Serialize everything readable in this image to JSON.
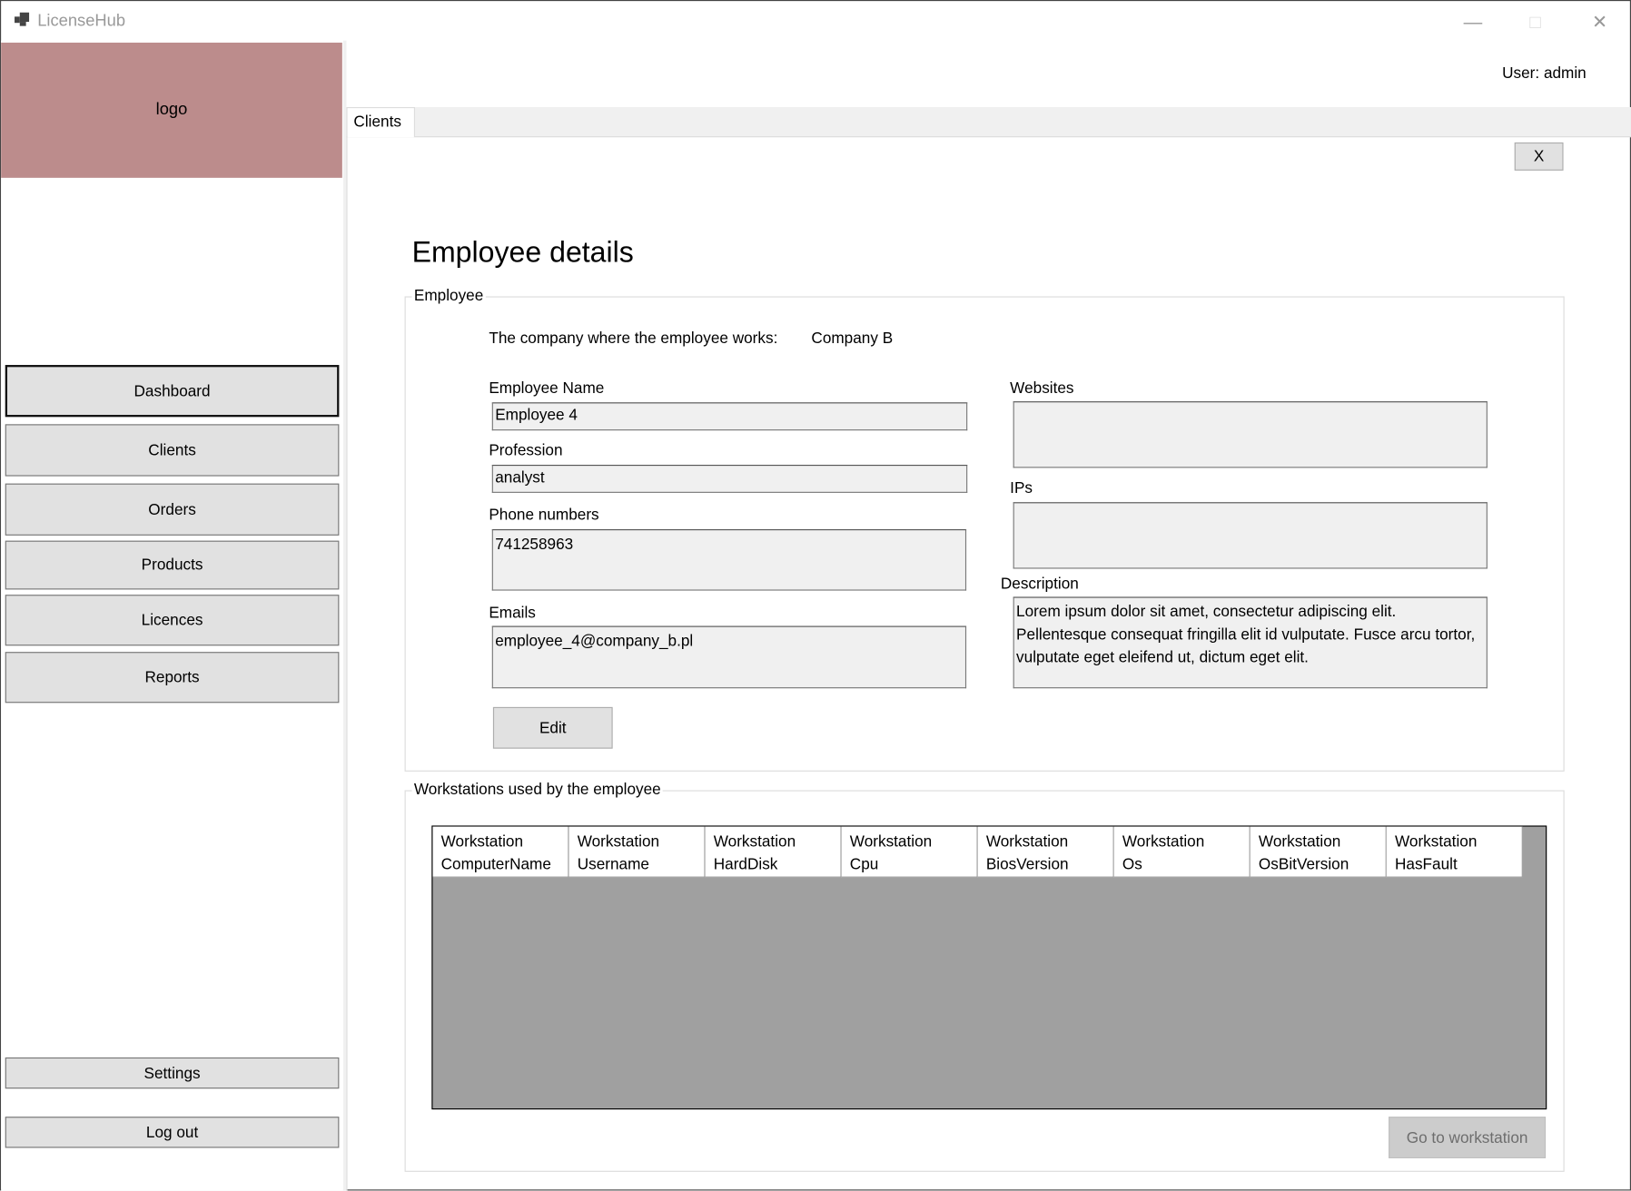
{
  "window": {
    "title": "LicenseHub",
    "controls": [
      "minimize",
      "maximize",
      "close"
    ]
  },
  "sidebar": {
    "logo": "logo",
    "items": [
      {
        "label": "Dashboard",
        "active": true
      },
      {
        "label": "Clients"
      },
      {
        "label": "Orders"
      },
      {
        "label": "Products"
      },
      {
        "label": "Licences"
      },
      {
        "label": "Reports"
      }
    ],
    "settings": "Settings",
    "logout": "Log out"
  },
  "header": {
    "user": "User: admin"
  },
  "tabs": [
    {
      "label": "Clients",
      "active": true
    }
  ],
  "page": {
    "close_label": "X",
    "title": "Employee details",
    "employee_group": {
      "legend": "Employee",
      "company_label": "The company where the employee works:",
      "company_value": "Company B",
      "name_label": "Employee Name",
      "name_value": "Employee 4",
      "profession_label": "Profession",
      "profession_value": "analyst",
      "phones_label": "Phone numbers",
      "phones_value": "741258963",
      "emails_label": "Emails",
      "emails_value": "employee_4@company_b.pl",
      "websites_label": "Websites",
      "websites_value": "",
      "ips_label": "IPs",
      "ips_value": "",
      "description_label": "Description",
      "description_value": "Lorem ipsum dolor sit amet, consectetur adipiscing elit. Pellentesque consequat fringilla elit id vulputate. Fusce arcu tortor, vulputate eget eleifend ut, dictum eget elit.",
      "edit_label": "Edit"
    },
    "workstations_group": {
      "legend": "Workstations used by the employee",
      "columns": [
        "Workstation\nComputerName",
        "Workstation\nUsername",
        "Workstation\nHardDisk",
        "Workstation\nCpu",
        "Workstation\nBiosVersion",
        "Workstation\nOs",
        "Workstation\nOsBitVersion",
        "Workstation\nHasFault"
      ],
      "rows": [],
      "go_label": "Go to workstation"
    }
  },
  "colors": {
    "logo_bg": "#bc8c8c",
    "grid_bg": "#a0a0a0",
    "disabled_button": "#cccccc"
  }
}
